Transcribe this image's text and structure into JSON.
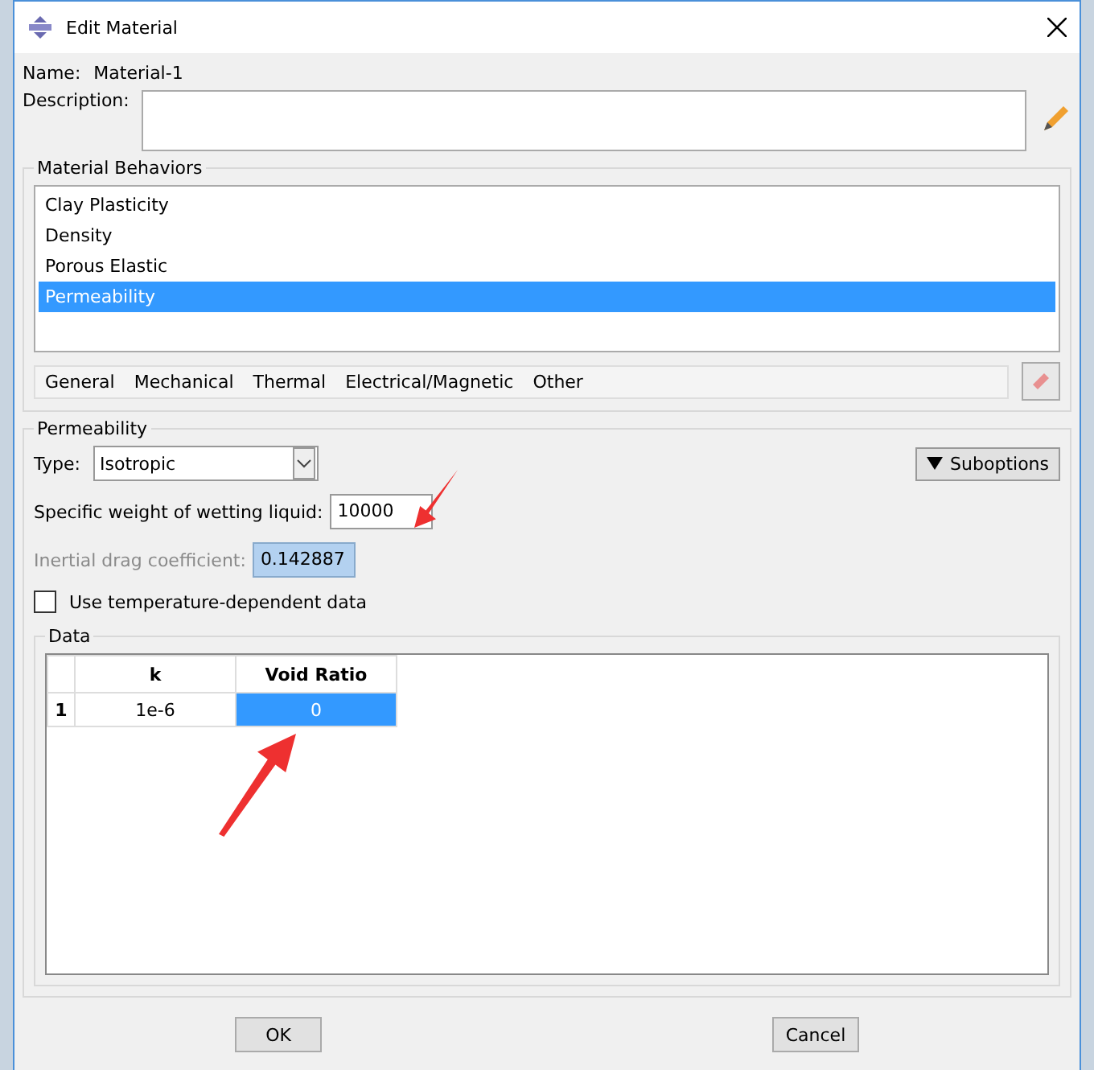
{
  "window": {
    "title": "Edit Material"
  },
  "name": {
    "label": "Name:",
    "value": "Material-1"
  },
  "description": {
    "label": "Description:"
  },
  "behaviors": {
    "title": "Material Behaviors",
    "items": [
      {
        "label": "Clay Plasticity",
        "selected": false
      },
      {
        "label": "Density",
        "selected": false
      },
      {
        "label": "Porous Elastic",
        "selected": false
      },
      {
        "label": "Permeability",
        "selected": true
      }
    ]
  },
  "menus": [
    "General",
    "Mechanical",
    "Thermal",
    "Electrical/Magnetic",
    "Other"
  ],
  "permeability": {
    "title": "Permeability",
    "type_label": "Type:",
    "type_value": "Isotropic",
    "suboptions": "Suboptions",
    "specific_weight": {
      "label": "Specific weight of wetting liquid:",
      "value": "10000",
      "disabled": false
    },
    "inertial_drag": {
      "label": "Inertial drag coefficient:",
      "value": "0.142887",
      "disabled": true
    },
    "temperature_dependent": {
      "label": "Use temperature-dependent data",
      "checked": false
    }
  },
  "data": {
    "title": "Data",
    "columns": [
      "k",
      "Void Ratio"
    ],
    "rows": [
      {
        "index": "1",
        "cells": [
          {
            "value": "1e-6",
            "selected": false
          },
          {
            "value": "0",
            "selected": true
          }
        ]
      }
    ]
  },
  "buttons": [
    "OK",
    "Cancel"
  ]
}
